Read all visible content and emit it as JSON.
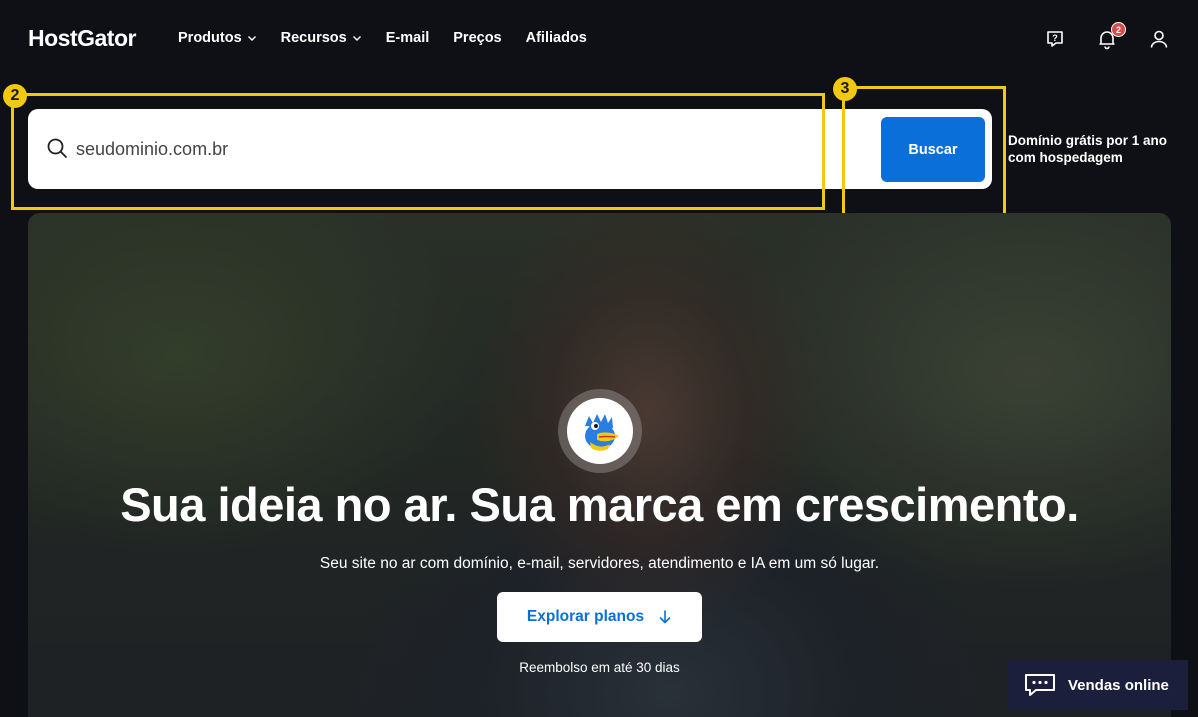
{
  "header": {
    "logo": "HostGator",
    "nav": [
      {
        "label": "Produtos",
        "has_dropdown": true
      },
      {
        "label": "Recursos",
        "has_dropdown": true
      },
      {
        "label": "E-mail",
        "has_dropdown": false
      },
      {
        "label": "Preços",
        "has_dropdown": false
      },
      {
        "label": "Afiliados",
        "has_dropdown": false
      }
    ],
    "notification_count": "2"
  },
  "search": {
    "placeholder": "seudominio.com.br",
    "button_label": "Buscar",
    "promo": "Domínio grátis por 1 ano com hospedagem"
  },
  "annotations": {
    "box_2_number": "2",
    "box_3_number": "3"
  },
  "hero": {
    "title": "Sua ideia no ar. Sua marca em crescimento.",
    "subtitle": "Seu site no ar com domínio, e-mail, servidores, atendimento e IA em um só lugar.",
    "cta_label": "Explorar planos",
    "note": "Reembolso em até 30 dias"
  },
  "chat": {
    "label": "Vendas online"
  },
  "colors": {
    "background": "#0f1016",
    "brand_blue": "#0a6fd8",
    "annotation_yellow": "#f2c811",
    "chat_bg": "#1b1f3b"
  }
}
